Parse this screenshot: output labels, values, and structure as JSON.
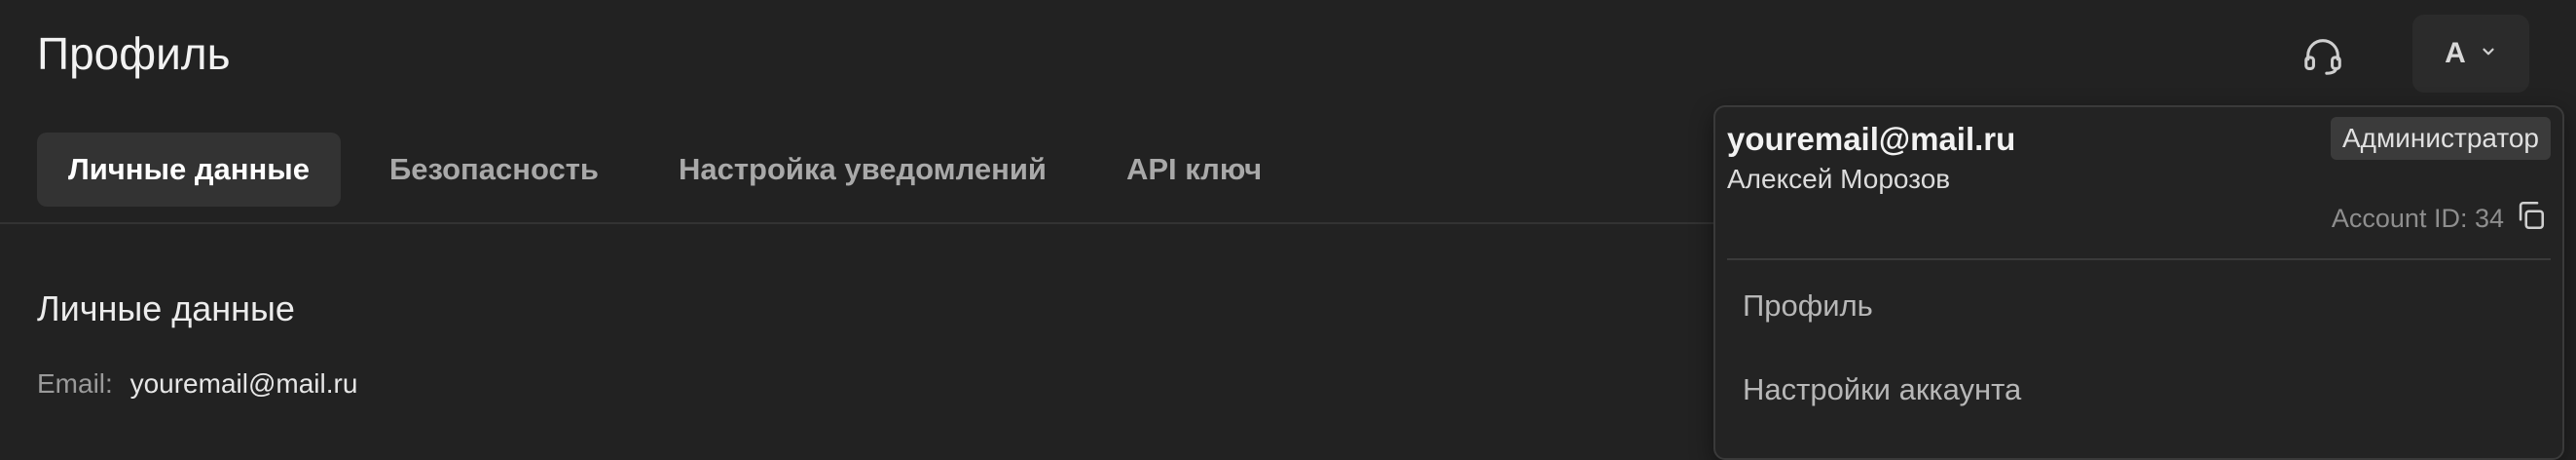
{
  "header": {
    "title": "Профиль",
    "avatar_letter": "А"
  },
  "tabs": [
    {
      "label": "Личные данные",
      "active": true
    },
    {
      "label": "Безопасность",
      "active": false
    },
    {
      "label": "Настройка уведомлений",
      "active": false
    },
    {
      "label": "API ключ",
      "active": false
    }
  ],
  "section": {
    "title": "Личные данные",
    "email_label": "Email:",
    "email_value": "youremail@mail.ru"
  },
  "dropdown": {
    "email": "youremail@mail.ru",
    "role": "Администратор",
    "name": "Алексей Морозов",
    "account_id": "Account ID: 34",
    "menu": [
      {
        "label": "Профиль"
      },
      {
        "label": "Настройки аккаунта"
      }
    ]
  },
  "icons": {
    "support": "headset-icon",
    "avatar_menu": "chevron-down-icon",
    "copy": "copy-icon"
  },
  "colors": {
    "background": "#222222",
    "active_tab": "#333333",
    "role_badge": "#3b3b3b"
  }
}
